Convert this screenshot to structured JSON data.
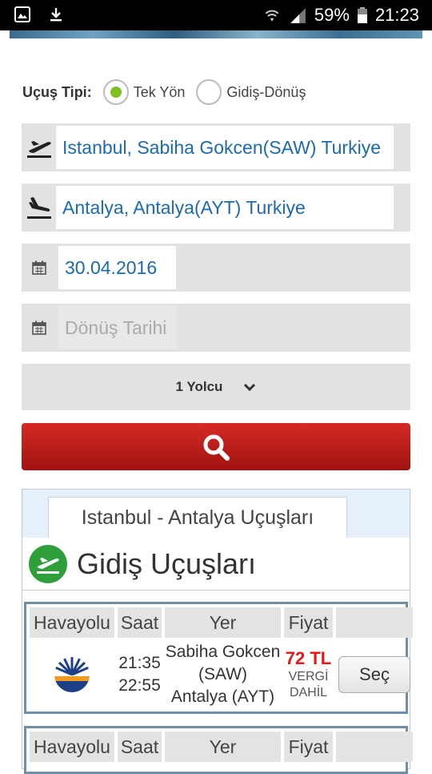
{
  "status_bar": {
    "battery": "59%",
    "time": "21:23"
  },
  "flight_type": {
    "label": "Uçuş Tipi:",
    "options": [
      {
        "label": "Tek Yön",
        "selected": true
      },
      {
        "label": "Gidiş-Dönüş",
        "selected": false
      }
    ]
  },
  "origin": {
    "value": "Istanbul, Sabiha Gokcen(SAW) Turkiye",
    "icon": "takeoff-icon"
  },
  "destination": {
    "value": "Antalya, Antalya(AYT) Turkiye",
    "icon": "landing-icon"
  },
  "departure_date": {
    "value": "30.04.2016",
    "icon": "calendar-icon"
  },
  "return_date": {
    "placeholder": "Dönüş Tarihi",
    "icon": "calendar-icon"
  },
  "passengers": {
    "label": "1 Yolcu"
  },
  "search": {
    "icon": "search-icon",
    "color": "#c21f1b"
  },
  "results": {
    "tab_title": "Istanbul - Antalya Uçuşları",
    "section_title": "Gidiş Uçuşları",
    "columns": [
      "Havayolu",
      "Saat",
      "Yer",
      "Fiyat",
      ""
    ],
    "flights": [
      {
        "airline": "airline-logo",
        "depart": "21:35",
        "arrive": "22:55",
        "from": "Sabiha Gokcen (SAW)",
        "to": "Antalya (AYT)",
        "price": "72 TL",
        "tax_line1": "VERGİ",
        "tax_line2": "DAHİL",
        "select_label": "Seç"
      }
    ],
    "second_card_columns": [
      "Havayolu",
      "Saat",
      "Yer",
      "Fiyat",
      ""
    ]
  }
}
